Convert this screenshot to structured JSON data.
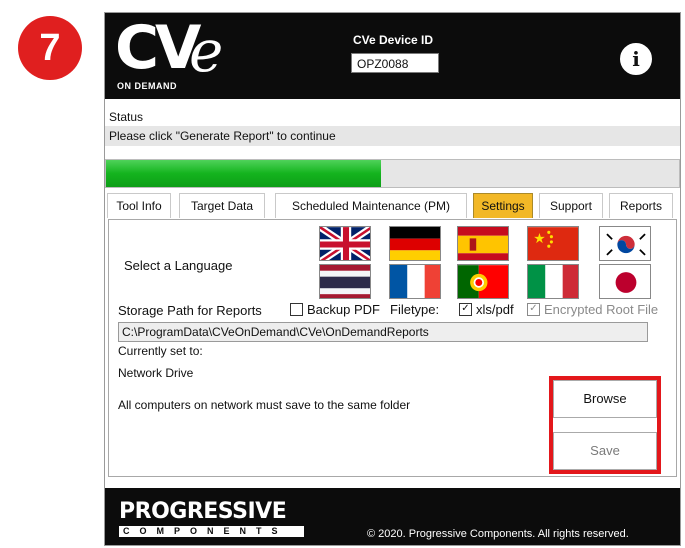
{
  "step": "7",
  "header": {
    "logo_text": "CV",
    "logo_e": "e",
    "logo_sub": "ON DEMAND",
    "device_label": "CVe Device ID",
    "device_id": "OPZ0088",
    "info_icon": "info-icon"
  },
  "status": {
    "label": "Status",
    "text": "Please click \"Generate Report\" to continue",
    "progress_fraction": 0.48
  },
  "tabs": [
    {
      "label": "Tool Info",
      "active": false
    },
    {
      "label": "Target Data",
      "active": false
    },
    {
      "label": "Scheduled Maintenance (PM)",
      "active": false
    },
    {
      "label": "Settings",
      "active": true
    },
    {
      "label": "Support",
      "active": false
    },
    {
      "label": "Reports",
      "active": false
    }
  ],
  "settings": {
    "language_label": "Select a Language",
    "flags": [
      "uk",
      "germany",
      "spain",
      "china",
      "korea",
      "thailand",
      "france",
      "portugal",
      "italy",
      "japan"
    ],
    "storage_label": "Storage Path for Reports",
    "backup_pdf": {
      "label": "Backup PDF",
      "checked": false
    },
    "filetype_label": "Filetype:",
    "xls_pdf": {
      "label": "xls/pdf",
      "checked": true
    },
    "encrypted": {
      "label": "Encrypted Root File",
      "checked": true,
      "enabled": false
    },
    "path": "C:\\ProgramData\\CVeOnDemand\\CVe\\OnDemandReports",
    "current_label": "Currently set to:",
    "network_label": "Network Drive",
    "note": "All computers on network must save to the same folder",
    "browse_label": "Browse",
    "save_label": "Save"
  },
  "footer": {
    "brand": "PROGRESSIVE",
    "brand_sub": "COMPONENTS",
    "copyright": "© 2020. Progressive Components. All rights reserved."
  },
  "colors": {
    "badge": "#e01f1f",
    "header_bg": "#0c0c0c",
    "progress": "#14b41e",
    "active_tab": "#f2b827",
    "highlight_border": "#e3171b"
  }
}
